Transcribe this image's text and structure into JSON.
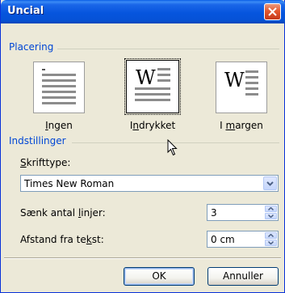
{
  "window": {
    "title": "Uncial"
  },
  "placement": {
    "group_label": "Placering",
    "options": [
      {
        "label_u": "I",
        "label_rest": "ngen",
        "selected": false
      },
      {
        "label_pre": "I",
        "label_u": "n",
        "label_rest": "drykket",
        "selected": true
      },
      {
        "label_pre": "I ",
        "label_u": "m",
        "label_rest": "argen",
        "selected": false
      }
    ]
  },
  "settings": {
    "group_label": "Indstillinger",
    "font_label_u": "S",
    "font_label_rest": "krifttype:",
    "font_value": "Times New Roman",
    "lines_label_pre": "Sænk antal ",
    "lines_label_u": "l",
    "lines_label_rest": "injer:",
    "lines_value": "3",
    "distance_label_pre": "Afstand fra te",
    "distance_label_u": "k",
    "distance_label_rest": "st:",
    "distance_value": "0 cm"
  },
  "buttons": {
    "ok": "OK",
    "cancel": "Annuller"
  },
  "colors": {
    "titlebar": "#0655DE",
    "group_label": "#0046D5",
    "face": "#ECE9D8"
  }
}
